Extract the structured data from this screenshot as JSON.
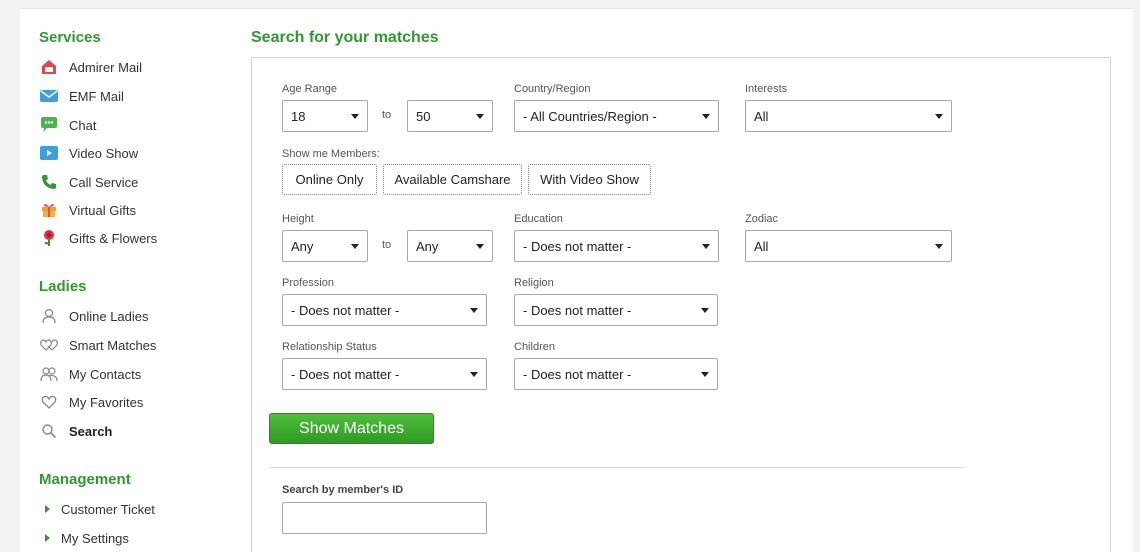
{
  "sidebar": {
    "services_heading": "Services",
    "services": [
      {
        "label": "Admirer Mail",
        "icon": "admirer-mail-icon"
      },
      {
        "label": "EMF Mail",
        "icon": "emf-mail-icon"
      },
      {
        "label": "Chat",
        "icon": "chat-icon"
      },
      {
        "label": "Video Show",
        "icon": "video-show-icon"
      },
      {
        "label": "Call Service",
        "icon": "phone-icon"
      },
      {
        "label": "Virtual Gifts",
        "icon": "gift-icon"
      },
      {
        "label": "Gifts & Flowers",
        "icon": "flower-icon"
      }
    ],
    "ladies_heading": "Ladies",
    "ladies": [
      {
        "label": "Online Ladies",
        "icon": "person-icon"
      },
      {
        "label": "Smart Matches",
        "icon": "hearts-icon"
      },
      {
        "label": "My Contacts",
        "icon": "contacts-icon"
      },
      {
        "label": "My Favorites",
        "icon": "heart-icon"
      },
      {
        "label": "Search",
        "icon": "search-icon",
        "active": true
      }
    ],
    "management_heading": "Management",
    "management": [
      {
        "label": "Customer Ticket",
        "icon": "triangle-right-icon"
      },
      {
        "label": "My Settings",
        "icon": "triangle-right-icon"
      }
    ]
  },
  "main": {
    "title": "Search for your matches",
    "age_range_label": "Age Range",
    "age_from": "18",
    "to_label": "to",
    "age_to": "50",
    "country_label": "Country/Region",
    "country_value": "- All Countries/Region -",
    "interests_label": "Interests",
    "interests_value": "All",
    "show_members_label": "Show me Members:",
    "chips": [
      "Online Only",
      "Available Camshare",
      "With Video Show"
    ],
    "height_label": "Height",
    "height_from": "Any",
    "height_to": "Any",
    "education_label": "Education",
    "education_value": "- Does not matter -",
    "zodiac_label": "Zodiac",
    "zodiac_value": "All",
    "profession_label": "Profession",
    "profession_value": "- Does not matter -",
    "religion_label": "Religion",
    "religion_value": "- Does not matter -",
    "relationship_label": "Relationship Status",
    "relationship_value": "- Does not matter -",
    "children_label": "Children",
    "children_value": "- Does not matter -",
    "show_matches_button": "Show Matches",
    "search_by_id_label": "Search by member's ID",
    "search_by_id_value": ""
  },
  "colors": {
    "accent_green": "#2f9a2f",
    "button_green": "#3aaa2c"
  }
}
